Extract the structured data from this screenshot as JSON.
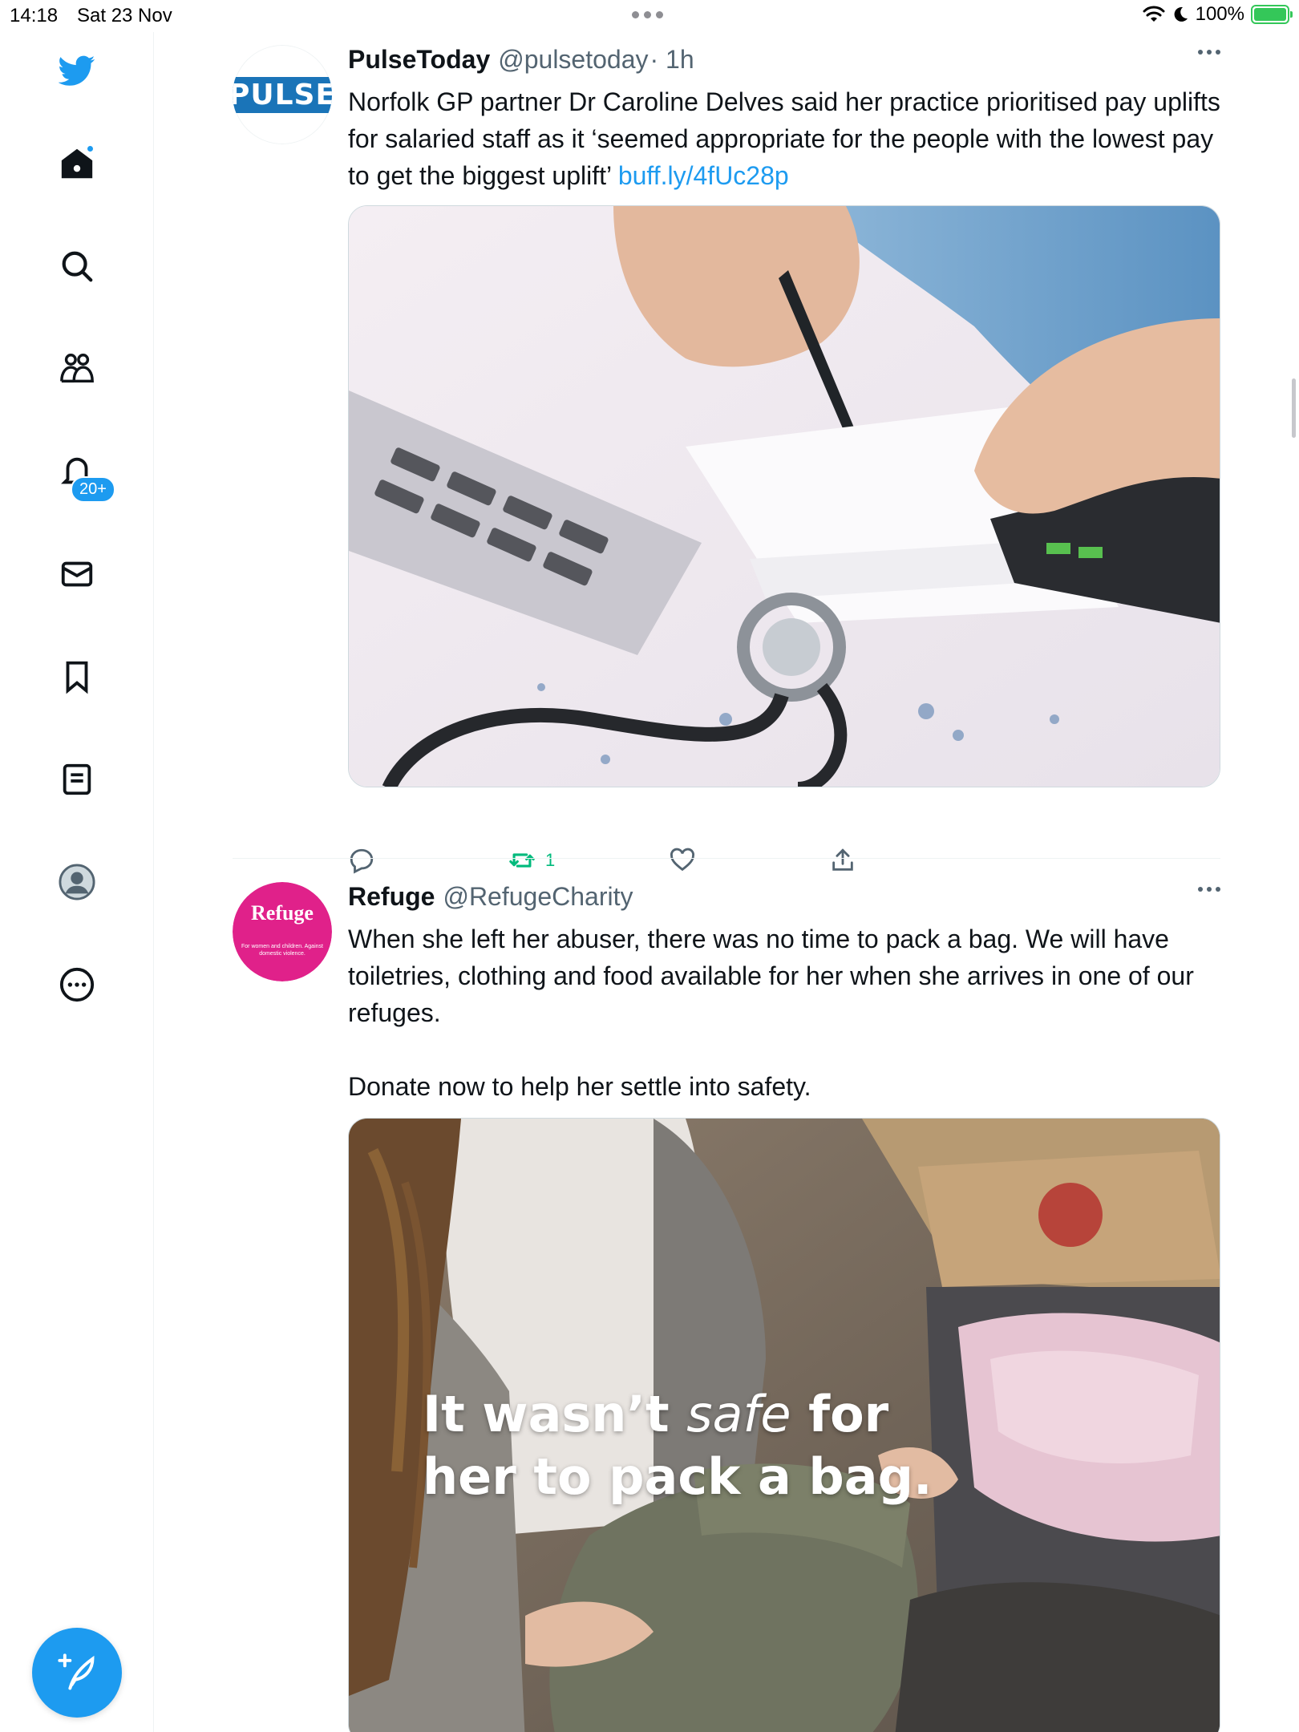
{
  "status_bar": {
    "time": "14:18",
    "date": "Sat 23 Nov",
    "battery": "100%"
  },
  "sidebar": {
    "items": [
      {
        "name": "twitter-logo-icon"
      },
      {
        "name": "home-icon"
      },
      {
        "name": "search-icon"
      },
      {
        "name": "communities-icon"
      },
      {
        "name": "notifications-icon"
      },
      {
        "name": "messages-icon"
      },
      {
        "name": "bookmarks-icon"
      },
      {
        "name": "lists-icon"
      },
      {
        "name": "profile-icon"
      },
      {
        "name": "more-icon"
      }
    ],
    "notification_badge": "20+",
    "compose_icon": "compose-icon"
  },
  "colors": {
    "accent": "#1d9bf0",
    "retweet_green": "#00ba7c",
    "pulse_blue": "#1a74b8",
    "refuge_pink": "#e0218a"
  },
  "tweets": [
    {
      "name": "PulseToday",
      "handle": "@pulsetoday",
      "time": "· 1h",
      "avatar_text": "PULSE",
      "text": "Norfolk GP partner Dr Caroline Delves said her practice prioritised pay uplifts for salaried staff as it ‘seemed appropriate for the people with the lowest pay to get the biggest uplift’ ",
      "link": "buff.ly/4fUc28p",
      "retweets": "1"
    },
    {
      "name": "Refuge",
      "handle": "@RefugeCharity",
      "avatar_title": "Refuge",
      "avatar_sub": "For women and children. Against domestic violence.",
      "text": "When she left her abuser, there was no time to pack a bag. We will have toiletries, clothing and food available for her when she arrives in one of our refuges.\n\nDonate now to help her settle into safety.",
      "image_text_1": "It wasn’t ",
      "image_text_safe": "safe",
      "image_text_2": " for",
      "image_text_3": "her to pack a bag."
    }
  ]
}
